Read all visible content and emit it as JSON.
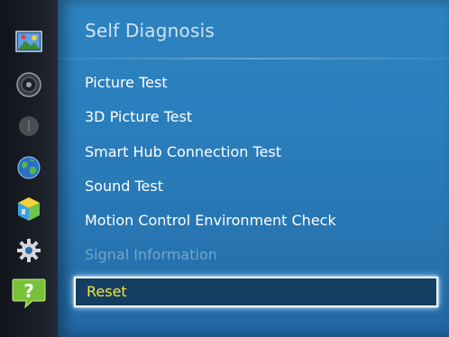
{
  "sidebar": {
    "icons": [
      {
        "name": "picture-icon"
      },
      {
        "name": "sound-icon"
      },
      {
        "name": "broadcast-icon"
      },
      {
        "name": "network-icon"
      },
      {
        "name": "system-icon"
      },
      {
        "name": "settings-icon"
      },
      {
        "name": "support-icon",
        "glyph": "?",
        "active": true
      }
    ]
  },
  "panel": {
    "title": "Self Diagnosis",
    "items": [
      {
        "label": "Picture Test",
        "state": "normal"
      },
      {
        "label": "3D Picture Test",
        "state": "normal"
      },
      {
        "label": "Smart Hub Connection Test",
        "state": "normal"
      },
      {
        "label": "Sound Test",
        "state": "normal"
      },
      {
        "label": "Motion Control Environment Check",
        "state": "normal"
      },
      {
        "label": "Signal Information",
        "state": "disabled"
      },
      {
        "label": "Reset",
        "state": "selected"
      }
    ]
  },
  "colors": {
    "panel": "#2a7fbd",
    "selected_text": "#f5e63a",
    "disabled_text": "#6fa6d0",
    "support_icon": "#7ac13a"
  }
}
